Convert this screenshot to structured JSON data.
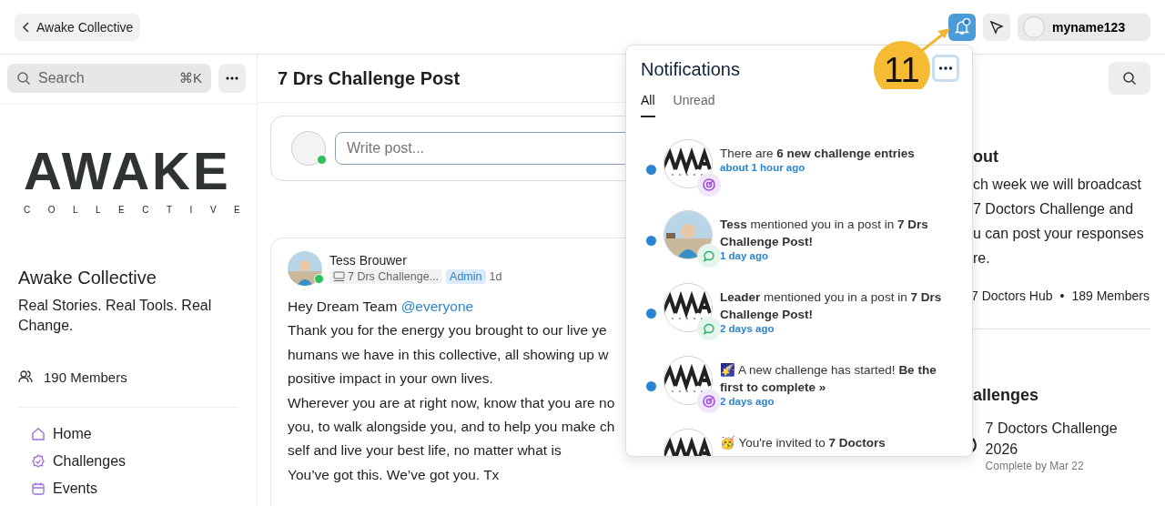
{
  "topbar": {
    "back_label": "Awake Collective",
    "bell_active": true,
    "bell_unread": true,
    "username": "myname123"
  },
  "sidebar": {
    "search": {
      "placeholder": "Search",
      "shortcut": "⌘K"
    },
    "logo": {
      "word": "AWAKE",
      "sub": "COLLECTIVE"
    },
    "title": "Awake Collective",
    "description": "Real Stories. Real Tools. Real Change.",
    "members": "190 Members",
    "nav": [
      {
        "label": "Home",
        "kind": "home"
      },
      {
        "label": "Challenges",
        "kind": "badge"
      },
      {
        "label": "Events",
        "kind": "calendar"
      }
    ]
  },
  "main": {
    "title": "7 Drs Challenge Post",
    "composer": {
      "placeholder": "Write post..."
    },
    "post": {
      "author": "Tess Brouwer",
      "space": "7 Drs Challenge...",
      "role": "Admin",
      "time": "1d",
      "greeting": "Hey Dream Team",
      "mention": "@everyone",
      "lines": [
        "Thank you for the energy you brought to our live ye",
        "humans we have in this collective, all showing up w",
        "positive impact in your own lives.",
        "Wherever you are at right now, know that you are no",
        "you, to walk alongside you, and to help you make ch",
        "self and live your best life, no matter what is",
        "You’ve got this. We’ve got you. Tx"
      ]
    }
  },
  "notifications": {
    "title": "Notifications",
    "tabs": [
      {
        "label": "All",
        "selected": true
      },
      {
        "label": "Unread",
        "selected": false
      }
    ],
    "items": [
      {
        "avatar": {
          "kind": "logo"
        },
        "kind": "challenge",
        "unread": true,
        "text": "There are **6 new challenge entries**",
        "time": "about 1 hour ago"
      },
      {
        "kind": "mention",
        "unread": true,
        "text": "**Tess** mentioned you in a post in **7 Drs Challenge Post!**",
        "time": "1 day ago"
      },
      {
        "avatar": {
          "kind": "logo"
        },
        "kind": "mention",
        "unread": true,
        "text": "**Leader** mentioned you in a post in **7 Drs Challenge Post!**",
        "time": "2 days ago"
      },
      {
        "avatar": {
          "kind": "logo"
        },
        "kind": "challenge",
        "unread": true,
        "text": "🌠 A new challenge has started! **Be the first to complete »**",
        "time": "2 days ago"
      },
      {
        "avatar": {
          "kind": "logo"
        },
        "text": "🥳 You're invited to **7 Doctors**"
      }
    ]
  },
  "annotation": {
    "label": "11"
  },
  "right": {
    "about_heading": "out",
    "about_lines": [
      "ch week we will broadcast",
      "7 Doctors Challenge and",
      "u can post your responses",
      "re."
    ],
    "hub": "7 Doctors Hub",
    "separator": "•",
    "hub_members": "189 Members",
    "challenges_heading": "allenges",
    "challenge": {
      "title": "7 Doctors Challenge 2026",
      "due": "Complete by Mar 22"
    }
  }
}
